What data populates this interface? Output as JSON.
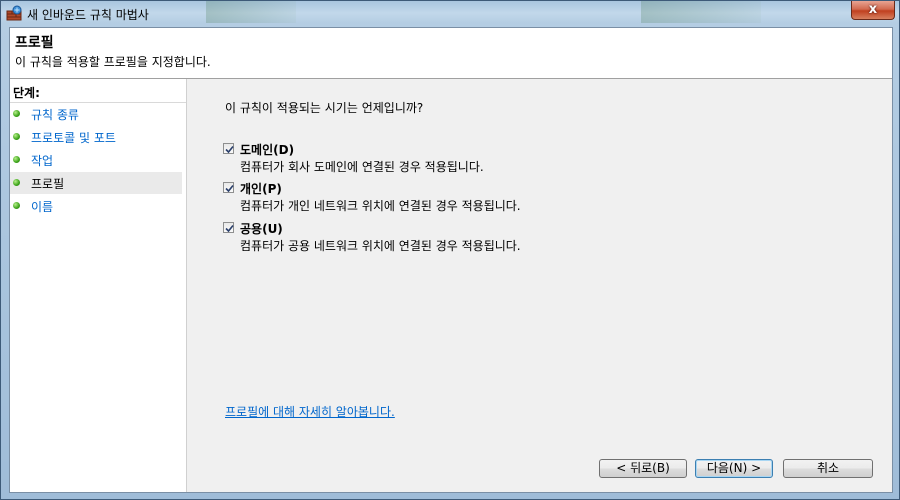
{
  "window": {
    "title": "새 인바운드 규칙 마법사",
    "close_label": "x",
    "icon": "firewall-wizard-icon"
  },
  "header": {
    "title": "프로필",
    "description": "이 규칙을 적용할 프로필을 지정합니다."
  },
  "sidebar": {
    "heading": "단계:",
    "steps": [
      {
        "label": "규칙 종류",
        "active": false
      },
      {
        "label": "프로토콜 및 포트",
        "active": false
      },
      {
        "label": "작업",
        "active": false
      },
      {
        "label": "프로필",
        "active": true
      },
      {
        "label": "이름",
        "active": false
      }
    ]
  },
  "main": {
    "question": "이 규칙이 적용되는 시기는 언제입니까?",
    "options": [
      {
        "label": "도메인(D)",
        "description": "컴퓨터가 회사 도메인에 연결된 경우 적용됩니다.",
        "checked": true
      },
      {
        "label": "개인(P)",
        "description": "컴퓨터가 개인 네트워크 위치에 연결된 경우 적용됩니다.",
        "checked": true
      },
      {
        "label": "공용(U)",
        "description": "컴퓨터가 공용 네트워크 위치에 연결된 경우 적용됩니다.",
        "checked": true
      }
    ],
    "help_link": "프로필에 대해 자세히 알아봅니다."
  },
  "footer": {
    "back_label": "< 뒤로(B)",
    "next_label": "다음(N) >",
    "cancel_label": "취소"
  }
}
